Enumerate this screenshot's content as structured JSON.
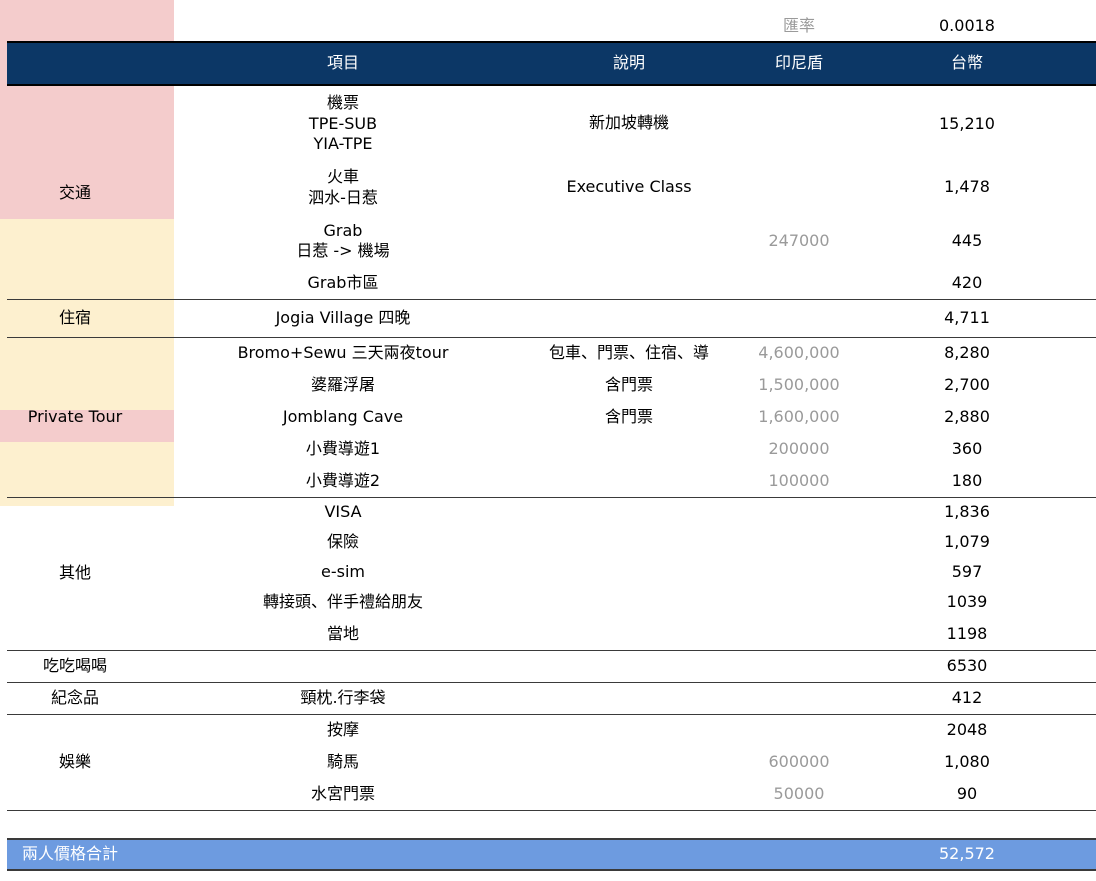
{
  "rate": {
    "label": "匯率",
    "value": "0.0018"
  },
  "header": {
    "item": "項目",
    "desc": "說明",
    "idr": "印尼盾",
    "twd": "台幣"
  },
  "rows": [
    {
      "category": "交通",
      "item": "機票\nTPE-SUB\nYIA-TPE",
      "desc": "新加坡轉機",
      "idr": "",
      "twd": "15,210",
      "highlight": "pink"
    },
    {
      "category": "",
      "item": "火車\n泗水-日惹",
      "desc": "Executive Class",
      "idr": "",
      "twd": "1,478",
      "highlight": "pink"
    },
    {
      "category": "",
      "item": "Grab\n日惹 -> 機場",
      "desc": "",
      "idr": "247000",
      "twd": "445",
      "highlight": "pink"
    },
    {
      "category": "",
      "item": "Grab市區",
      "desc": "",
      "idr": "",
      "twd": "420",
      "highlight": "none"
    },
    {
      "category": "住宿",
      "item": "Jogia Village 四晚",
      "desc": "",
      "idr": "",
      "twd": "4,711",
      "highlight": "pink"
    },
    {
      "category": "Private Tour",
      "item": "Bromo+Sewu 三天兩夜tour",
      "desc": "包車、門票、住宿、導",
      "idr": "4,600,000",
      "twd": "8,280",
      "highlight": "yellow"
    },
    {
      "category": "",
      "item": "婆羅浮屠",
      "desc": "含門票",
      "idr": "1,500,000",
      "twd": "2,700",
      "highlight": "yellow"
    },
    {
      "category": "",
      "item": "Jomblang Cave",
      "desc": "含門票",
      "idr": "1,600,000",
      "twd": "2,880",
      "highlight": "yellow"
    },
    {
      "category": "",
      "item": "小費導遊1",
      "desc": "",
      "idr": "200000",
      "twd": "360",
      "highlight": "yellow"
    },
    {
      "category": "",
      "item": "小費導遊2",
      "desc": "",
      "idr": "100000",
      "twd": "180",
      "highlight": "yellow"
    },
    {
      "category": "其他",
      "item": "VISA",
      "desc": "",
      "idr": "",
      "twd": "1,836",
      "highlight": "none"
    },
    {
      "category": "",
      "item": "保險",
      "desc": "",
      "idr": "",
      "twd": "1,079",
      "highlight": "none"
    },
    {
      "category": "",
      "item": "e-sim",
      "desc": "",
      "idr": "",
      "twd": "597",
      "highlight": "none"
    },
    {
      "category": "",
      "item": "轉接頭、伴手禮給朋友",
      "desc": "",
      "idr": "",
      "twd": "1039",
      "highlight": "yellow"
    },
    {
      "category": "",
      "item": "當地",
      "desc": "",
      "idr": "",
      "twd": "1198",
      "highlight": "none"
    },
    {
      "category": "吃吃喝喝",
      "item": "",
      "desc": "",
      "idr": "",
      "twd": "6530",
      "highlight": "none"
    },
    {
      "category": "紀念品",
      "item": "頸枕.行李袋",
      "desc": "",
      "idr": "",
      "twd": "412",
      "highlight": "pink"
    },
    {
      "category": "娛樂",
      "item": "按摩",
      "desc": "",
      "idr": "",
      "twd": "2048",
      "highlight": "none"
    },
    {
      "category": "",
      "item": "騎馬",
      "desc": "",
      "idr": "600000",
      "twd": "1,080",
      "highlight": "yellow"
    },
    {
      "category": "",
      "item": "水宮門票",
      "desc": "",
      "idr": "50000",
      "twd": "90",
      "highlight": "yellow"
    }
  ],
  "total": {
    "label": "兩人價格合計",
    "value": "52,572"
  }
}
